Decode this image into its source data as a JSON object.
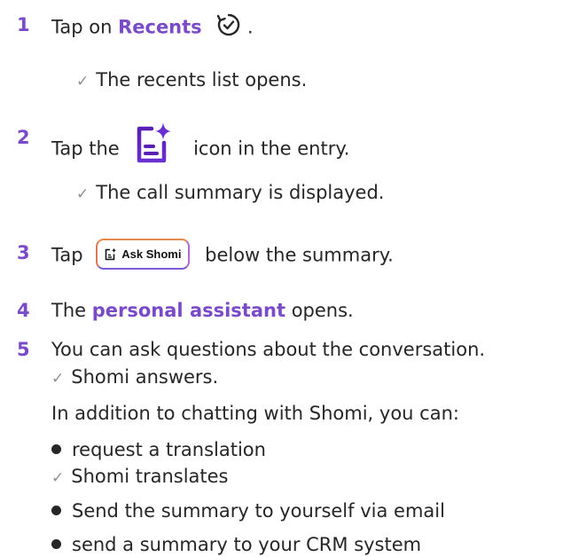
{
  "steps": [
    {
      "number": "1",
      "pre": "Tap on",
      "link": "Recents",
      "post": ".",
      "icon": "refresh-check-icon",
      "result": "The recents list opens."
    },
    {
      "number": "2",
      "pre": "Tap the",
      "post": "icon in the entry.",
      "icon": "summary-sparkle-icon",
      "result": "The call summary is displayed."
    },
    {
      "number": "3",
      "pre": "Tap",
      "button_label": "Ask Shomi",
      "post": "below the summary.",
      "icon": "summary-sparkle-icon"
    },
    {
      "number": "4",
      "pre": "The",
      "link": "personal assistant",
      "post": "opens."
    },
    {
      "number": "5",
      "text": "You can ask questions about the conversation.",
      "result": "Shomi answers.",
      "extra": "In addition to chatting with Shomi, you can:",
      "options": [
        {
          "text": "request a translation",
          "result": "Shomi translates"
        },
        {
          "text": "Send the summary to yourself via email"
        },
        {
          "text": "send a summary to your CRM system"
        }
      ]
    }
  ],
  "check_symbol": "✓",
  "colors": {
    "accent": "#7a4bc8",
    "text": "#262626",
    "check": "#8f8f8f"
  }
}
